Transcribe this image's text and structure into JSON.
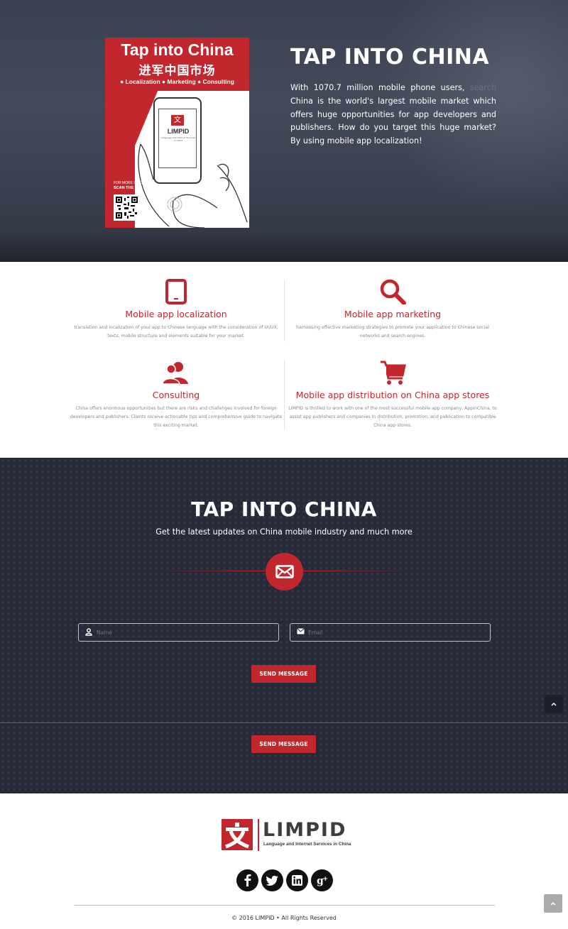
{
  "hero": {
    "poster": {
      "title": "Tap into China",
      "chinese": "进军中国市场",
      "tags": "● Localization ● Marketing ● Consulting",
      "logo_char": "文",
      "logo_name": "LIMPID",
      "logo_sub": "Language and Internet Services in China",
      "more_info": "FOR MORE INFO",
      "scan": "SCAN THE QR"
    },
    "heading": "TAP INTO CHINA",
    "intro_before": "With 1070.7 million mobile phone users, ",
    "intro_faint": "search",
    "intro_after": " China is the world's largest mobile market which offers huge opportunities for app developers and publishers. How do you target this huge market? By using mobile app localization!"
  },
  "services": [
    {
      "icon": "tablet-icon",
      "title": "Mobile app localization",
      "text": "translation and localization of your app to Chinese language with the consideration of UI/UX, texts, mobile structure and elements suitable for your market."
    },
    {
      "icon": "search-icon",
      "title": "Mobile app marketing",
      "text": "harnessing effective marketing strategies to promote your application to Chinese social networks and search engines."
    },
    {
      "icon": "users-icon",
      "title": "Consulting",
      "text": "China offers enormous opportunities but there are risks and challenges involved for foreign developers and publishers. Clients receive actionable tips and comprehensive guide to navigate this exciting market."
    },
    {
      "icon": "cart-icon",
      "title": "Mobile app distribution on China app stores",
      "text": "LIMPID is thrilled to work with one of the most successful mobile app company, AppInChina, to assist app publishers and companies in distribution, promotion, and publication to compatible China app stores."
    }
  ],
  "newsletter": {
    "heading": "TAP INTO CHINA",
    "subheading": "Get the latest updates on China mobile industry and much more",
    "name_placeholder": "Name",
    "email_placeholder": "Email",
    "send_label": "SEND MESSAGE",
    "send_label_2": "SEND MESSAGE"
  },
  "footer": {
    "logo_char": "文",
    "brand": "LIMPID",
    "tagline": "Language and Internet Services in China",
    "social": [
      {
        "icon": "facebook-icon",
        "glyph": "f"
      },
      {
        "icon": "twitter-icon",
        "glyph": "t"
      },
      {
        "icon": "linkedin-icon",
        "glyph": "in"
      },
      {
        "icon": "google-plus-icon",
        "glyph": "g+"
      }
    ],
    "copyright": "© 2016 LIMPID • All Rights Reserved"
  },
  "colors": {
    "accent": "#c1272d",
    "dark": "#262a38",
    "hero": "#3a4150"
  }
}
